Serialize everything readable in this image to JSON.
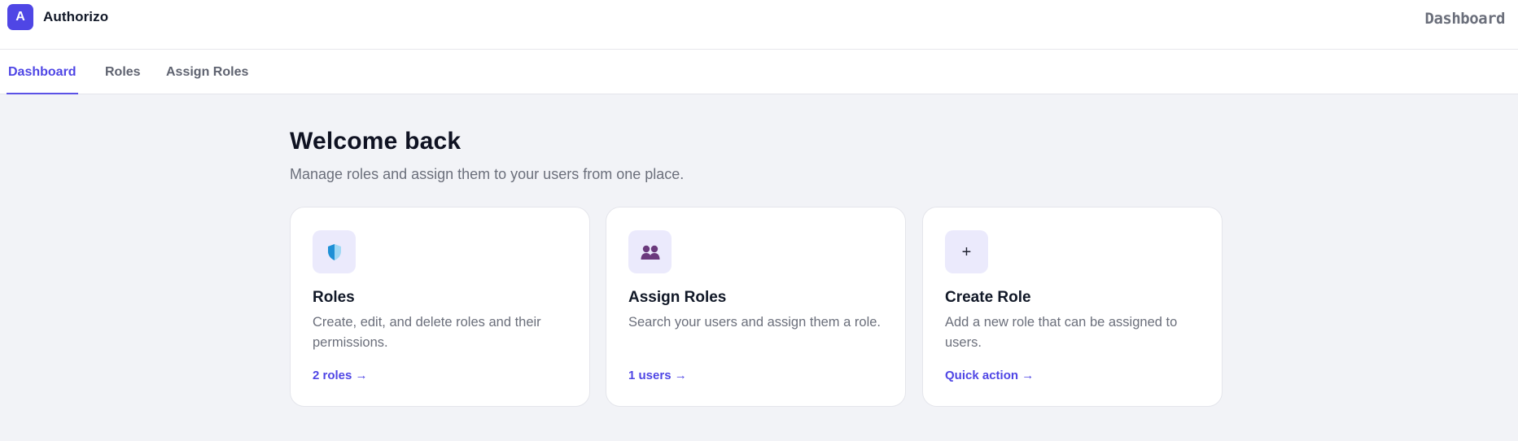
{
  "app": {
    "logo_letter": "A",
    "name": "Authorizo",
    "page_title": "Dashboard"
  },
  "tabs": [
    {
      "label": "Dashboard",
      "active": true
    },
    {
      "label": "Roles",
      "active": false
    },
    {
      "label": "Assign Roles",
      "active": false
    }
  ],
  "welcome": {
    "title": "Welcome back",
    "subtitle": "Manage roles and assign them to your users from one place."
  },
  "cards": [
    {
      "icon": "shield-icon",
      "title": "Roles",
      "description": "Create, edit, and delete roles and their permissions.",
      "link": "2 roles →"
    },
    {
      "icon": "users-icon",
      "title": "Assign Roles",
      "description": "Search your users and assign them a role.",
      "link": "1 users →"
    },
    {
      "icon": "plus-icon",
      "title": "Create Role",
      "description": "Add a new role that can be assigned to users.",
      "link": "Quick action →"
    }
  ],
  "colors": {
    "accent": "#4f46e5",
    "background": "#f2f3f7",
    "icon_bg": "#ebeafc"
  }
}
